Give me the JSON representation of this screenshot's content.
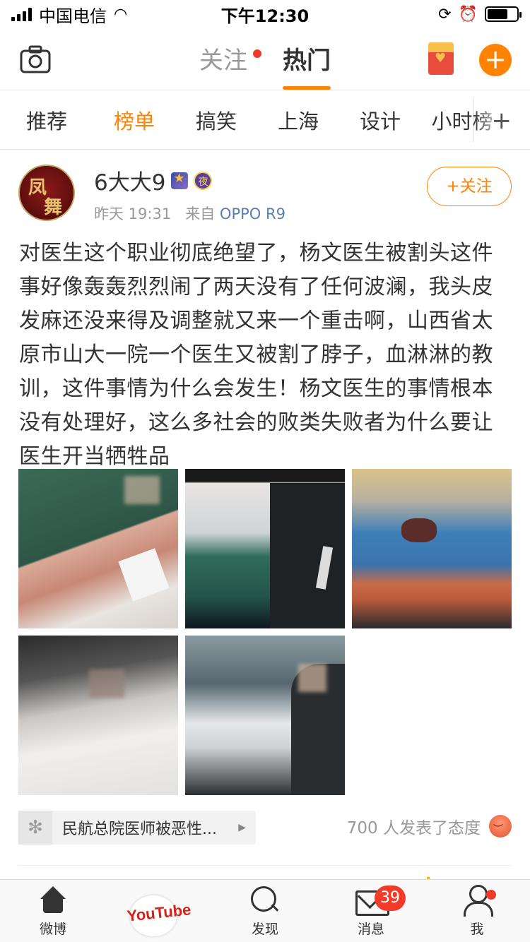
{
  "status": {
    "carrier": "中国电信",
    "time": "下午12:30"
  },
  "topnav": {
    "tab_follow": "关注",
    "tab_hot": "热门"
  },
  "categories": [
    "推荐",
    "榜单",
    "搞笑",
    "上海",
    "设计",
    "小时榜"
  ],
  "active_category": "榜单",
  "post": {
    "username": "6大大9",
    "time": "昨天 19:31",
    "from_label": "来自",
    "source": "OPPO R9",
    "follow_label": "+关注",
    "content": "对医生这个职业彻底绝望了，杨文医生被割头这件事好像轰轰烈烈闹了两天没有了任何波澜，我头皮发麻还没来得及调整就又来一个重击啊，山西省太原市山大一院一个医生又被割了脖子，血淋淋的教训，这件事情为什么会发生！杨文医生的事情根本没有处理好，这么多社会的败类失败者为什么要让医生开当牺牲品",
    "topic": "民航总院医师被恶性...",
    "attitude": "700 人发表了态度",
    "photo_count": 5
  },
  "tabbar": {
    "weibo": "微博",
    "center": "YouTube",
    "discover": "发现",
    "messages": "消息",
    "messages_badge": "39",
    "me": "我"
  },
  "colors": {
    "accent": "#ff8200",
    "badge": "#f03b2a",
    "link": "#5b7fb3"
  }
}
